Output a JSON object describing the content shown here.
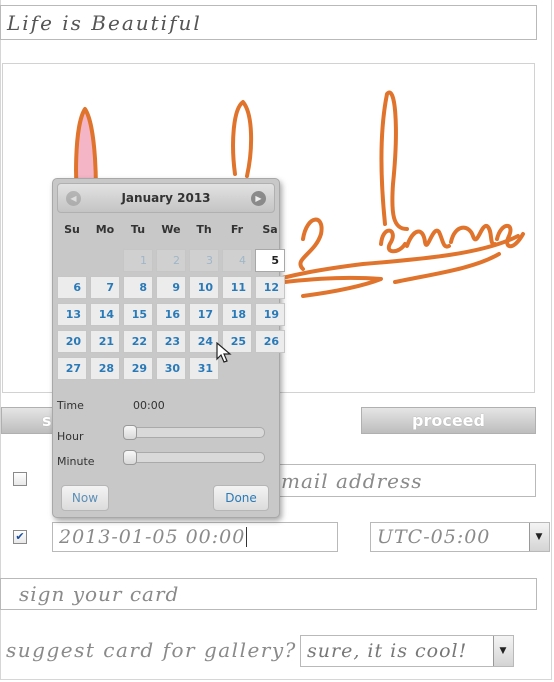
{
  "title_field": {
    "value": "Life  is  Beautiful"
  },
  "buttons": {
    "send_partial": "s",
    "proceed": "proceed"
  },
  "email": {
    "placeholder": "mail  address",
    "checked": false
  },
  "datetime": {
    "value": "2013-01-05  00:00",
    "checked": true,
    "timezone": "UTC-05:00"
  },
  "sign": {
    "placeholder": "sign  your  card"
  },
  "gallery": {
    "label": "suggest  card  for  gallery?",
    "value": "sure,  it  is  cool!"
  },
  "datepicker": {
    "month_title": "January 2013",
    "weekdays": [
      "Su",
      "Mo",
      "Tu",
      "We",
      "Th",
      "Fr",
      "Sa"
    ],
    "weeks": [
      [
        {
          "d": "",
          "t": "blank"
        },
        {
          "d": "",
          "t": "blank"
        },
        {
          "d": "1",
          "t": "other"
        },
        {
          "d": "2",
          "t": "other"
        },
        {
          "d": "3",
          "t": "other"
        },
        {
          "d": "4",
          "t": "other"
        },
        {
          "d": "5",
          "t": "active"
        }
      ],
      [
        {
          "d": "6"
        },
        {
          "d": "7"
        },
        {
          "d": "8"
        },
        {
          "d": "9"
        },
        {
          "d": "10"
        },
        {
          "d": "11"
        },
        {
          "d": "12"
        }
      ],
      [
        {
          "d": "13"
        },
        {
          "d": "14"
        },
        {
          "d": "15"
        },
        {
          "d": "16"
        },
        {
          "d": "17"
        },
        {
          "d": "18"
        },
        {
          "d": "19"
        }
      ],
      [
        {
          "d": "20"
        },
        {
          "d": "21"
        },
        {
          "d": "22"
        },
        {
          "d": "23"
        },
        {
          "d": "24"
        },
        {
          "d": "25"
        },
        {
          "d": "26"
        }
      ],
      [
        {
          "d": "27"
        },
        {
          "d": "28"
        },
        {
          "d": "29"
        },
        {
          "d": "30"
        },
        {
          "d": "31"
        },
        {
          "d": "",
          "t": "blank"
        },
        {
          "d": "",
          "t": "blank"
        }
      ]
    ],
    "time_label": "Time",
    "time_value": "00:00",
    "hour_label": "Hour",
    "minute_label": "Minute",
    "hour_value": 0,
    "minute_value": 0,
    "now_label": "Now",
    "done_label": "Done"
  },
  "colors": {
    "drawing_stroke": "#e0742c",
    "drawing_fill": "#f4b6c6",
    "link_blue": "#2a7ab8"
  },
  "icons": {
    "prev": "chevron-left-icon",
    "next": "chevron-right-icon",
    "select": "chevron-down-icon",
    "cursor": "mouse-pointer-icon"
  }
}
